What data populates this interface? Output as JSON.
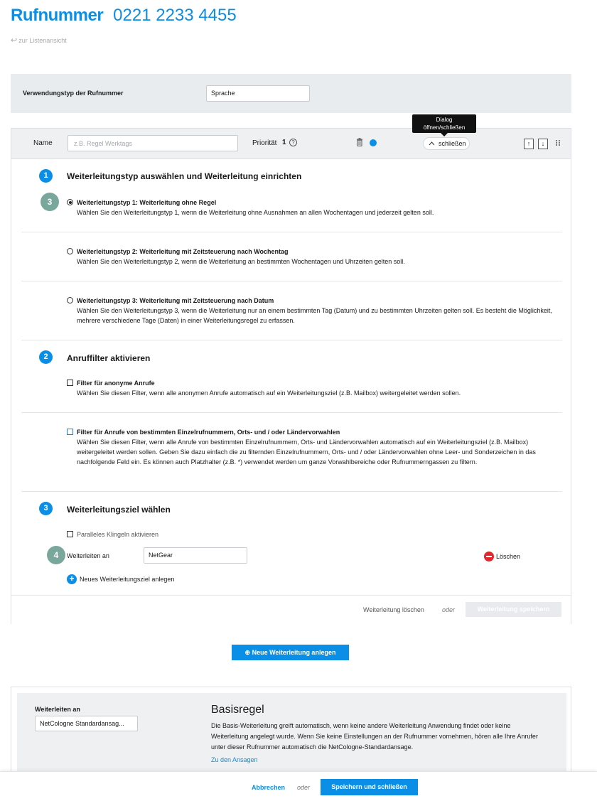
{
  "header": {
    "title_label": "Rufnummer",
    "phone_number": "0221 2233 4455",
    "back_link": "zur Listenansicht"
  },
  "usage": {
    "label": "Verwendungstyp der Rufnummer",
    "value": "Sprache"
  },
  "rule": {
    "name_label": "Name",
    "name_placeholder": "z.B. Regel Werktags",
    "priority_label": "Priorität",
    "priority_value": "1",
    "help_glyph": "?",
    "tooltip_line1": "Dialog",
    "tooltip_line2": "öffnen/schließen",
    "close_label": "schließen",
    "up_glyph": "↑",
    "down_glyph": "↓",
    "status_color": "#0a8ee6"
  },
  "section1": {
    "number": "1",
    "title": "Weiterleitungstyp auswählen und Weiterleitung einrichten",
    "badge": "3",
    "options": [
      {
        "title": "Weiterleitungstyp 1: Weiterleitung ohne Regel",
        "desc": "Wählen Sie den Weiterleitungstyp 1, wenn die Weiterleitung ohne Ausnahmen an allen Wochentagen und jederzeit gelten soll.",
        "selected": true
      },
      {
        "title": "Weiterleitungstyp 2: Weiterleitung mit Zeitsteuerung nach Wochentag",
        "desc": "Wählen Sie den Weiterleitungstyp 2, wenn die Weiterleitung an bestimmten Wochentagen und Uhrzeiten gelten soll.",
        "selected": false
      },
      {
        "title": "Weiterleitungstyp 3: Weiterleitung mit Zeitsteuerung nach Datum",
        "desc": "Wählen Sie den Weiterleitungstyp 3, wenn die Weiterleitung nur an einem bestimmten Tag (Datum) und zu bestimmten Uhrzeiten gelten soll. Es besteht die Möglichkeit, mehrere verschiedene Tage (Daten) in einer Weiterleitungsregel zu erfassen.",
        "selected": false
      }
    ]
  },
  "section2": {
    "number": "2",
    "title": "Anruffilter aktivieren",
    "filters": [
      {
        "title": "Filter für anonyme Anrufe",
        "desc": "Wählen Sie diesen Filter, wenn alle anonymen Anrufe automatisch auf ein Weiterleitungsziel (z.B. Mailbox) weitergeleitet werden sollen."
      },
      {
        "title": "Filter für Anrufe von bestimmten Einzelrufnummern, Orts- und / oder Ländervorwahlen",
        "desc": "Wählen Sie diesen Filter, wenn alle Anrufe von bestimmten Einzelrufnummern, Orts- und Ländervorwahlen automatisch auf ein Weiterleitungsziel (z.B. Mailbox) weitergeleitet werden sollen. Geben Sie dazu einfach die zu filternden Einzelrufnummern, Orts- und / oder Ländervorwahlen ohne Leer- und Sonderzeichen in das nachfolgende Feld ein. Es können auch Platzhalter (z.B. *) verwendet werden um ganze Vorwahlbereiche oder Rufnummerngassen zu filtern."
      }
    ]
  },
  "section3": {
    "number": "3",
    "title": "Weiterleitungsziel wählen",
    "parallel_label": "Paralleles Klingeln aktivieren",
    "badge": "4",
    "forward_label": "Weiterleiten an",
    "forward_value": "NetGear",
    "delete_label": "Löschen",
    "add_label": "Neues Weiterleitungsziel anlegen"
  },
  "rule_footer": {
    "delete_label": "Weiterleitung löschen",
    "or_label": "oder",
    "save_label": "Weiterleitung speichern"
  },
  "new_forwarding_label": "⊕ Neue Weiterleitung anlegen",
  "base": {
    "forward_label": "Weiterleiten an",
    "forward_value": "NetCologne Standardansag...",
    "title": "Basisregel",
    "text": "Die Basis-Weiterleitung greift automatisch, wenn keine andere Weiterleitung Anwendung findet oder keine Weiterleitung angelegt wurde. Wenn Sie keine Einstellungen an der Rufnummer vornehmen, hören alle Ihre Anrufer unter dieser Rufnummer automatisch die NetCologne-Standardansage.",
    "link": "Zu den Ansagen"
  },
  "bottom": {
    "cancel_label": "Abbrechen",
    "or_label": "oder",
    "save_label": "Speichern und schließen"
  },
  "colors": {
    "accent": "#0a8ee6",
    "badge_green": "#7aa79b",
    "delete_red": "#e3262b"
  }
}
